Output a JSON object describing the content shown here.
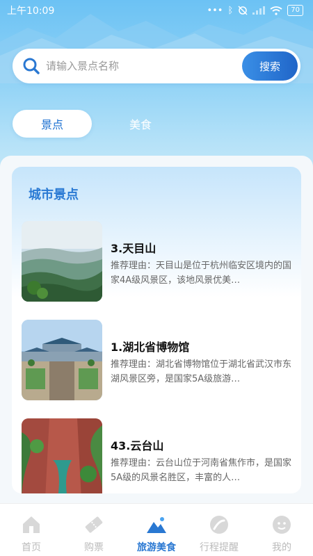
{
  "status_bar": {
    "time": "上午10:09",
    "battery": "70",
    "icons": [
      "dots-icon",
      "bluetooth-icon",
      "alarm-off-icon",
      "signal-icon",
      "wifi-icon",
      "battery-icon"
    ]
  },
  "search": {
    "placeholder": "请输入景点名称",
    "button_label": "搜索"
  },
  "tabs": [
    {
      "label": "景点",
      "active": true
    },
    {
      "label": "美食",
      "active": false
    }
  ],
  "section": {
    "title": "城市景点",
    "items": [
      {
        "title": "3.天目山",
        "desc": "推荐理由：天目山是位于杭州临安区境内的国家4A级风景区，该地风景优美…",
        "image": "mountain-photo"
      },
      {
        "title": "1.湖北省博物馆",
        "desc": "推荐理由：湖北省博物馆位于湖北省武汉市东湖风景区旁，是国家5A级旅游…",
        "image": "museum-photo"
      },
      {
        "title": "43.云台山",
        "desc": "推荐理由：云台山位于河南省焦作市，是国家5A级的风景名胜区，丰富的人…",
        "image": "canyon-photo"
      }
    ]
  },
  "tabbar": [
    {
      "label": "首页",
      "icon": "home-icon",
      "active": false
    },
    {
      "label": "购票",
      "icon": "ticket-icon",
      "active": false
    },
    {
      "label": "旅游美食",
      "icon": "travel-food-icon",
      "active": true
    },
    {
      "label": "行程提醒",
      "icon": "reminder-icon",
      "active": false
    },
    {
      "label": "我的",
      "icon": "profile-icon",
      "active": false
    }
  ],
  "colors": {
    "accent": "#2a78d2",
    "search_button": "#2065c8",
    "inactive_tab": "#bbbbbb"
  }
}
